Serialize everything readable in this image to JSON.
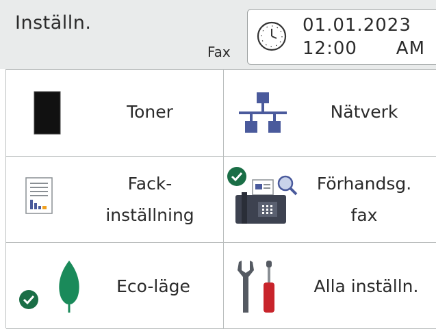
{
  "header": {
    "title": "Inställn.",
    "mode": "Fax",
    "date": "01.01.2023",
    "time": "12:00",
    "ampm": "AM"
  },
  "icons": {
    "clock": "clock-icon",
    "toner": "toner-icon",
    "network": "network-icon",
    "tray": "tray-settings-icon",
    "fax_preview": "fax-preview-icon",
    "eco": "eco-leaf-icon",
    "all_settings": "tools-icon",
    "check": "check-badge-icon"
  },
  "colors": {
    "header_bg": "#e9ebeb",
    "icon_blue": "#4a5a9c",
    "check_green": "#1a6e46",
    "leaf_green": "#1a8a5a",
    "tool_red": "#c8242b",
    "fax_dark": "#3d4250"
  },
  "tiles": {
    "toner": "Toner",
    "network": "Nätverk",
    "tray_line1": "Fack-",
    "tray_line2": "inställning",
    "fax_line1": "Förhandsg.",
    "fax_line2": "fax",
    "eco": "Eco-läge",
    "all": "Alla inställn."
  }
}
